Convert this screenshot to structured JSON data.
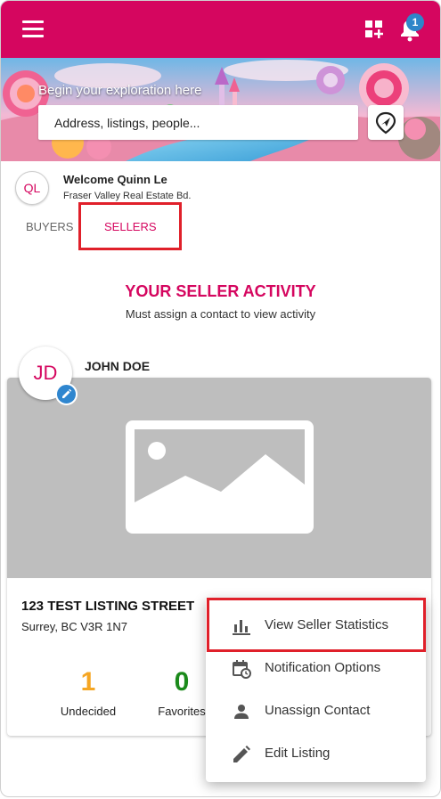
{
  "header": {
    "notification_count": "1",
    "brand_color": "#d5065f",
    "icons": [
      "menu-icon",
      "dashboard-add-icon",
      "notifications-icon"
    ]
  },
  "banner": {
    "title": "Begin your exploration here",
    "search_placeholder": "Address, listings, people..."
  },
  "user": {
    "initials": "QL",
    "welcome": "Welcome Quinn Le",
    "board": "Fraser Valley Real Estate Bd."
  },
  "tabs": [
    {
      "label": "BUYERS",
      "active": false
    },
    {
      "label": "SELLERS",
      "active": true
    }
  ],
  "activity": {
    "title": "YOUR SELLER ACTIVITY",
    "subtitle": "Must assign a contact to view activity"
  },
  "listing": {
    "contact_initials": "JD",
    "contact_name": "JOHN DOE",
    "street": "123 TEST LISTING STREET",
    "city": "Surrey, BC V3R 1N7",
    "stats": [
      {
        "value": "1",
        "label": "Undecided",
        "color": "#f5a623"
      },
      {
        "value": "0",
        "label": "Favorites",
        "color": "#1b8a1b"
      }
    ]
  },
  "menu": {
    "items": [
      {
        "label": "View Seller Statistics",
        "icon": "bar-chart-icon",
        "highlighted": true
      },
      {
        "label": "Notification Options",
        "icon": "calendar-clock-icon"
      },
      {
        "label": "Unassign Contact",
        "icon": "person-icon"
      },
      {
        "label": "Edit Listing",
        "icon": "pencil-icon"
      }
    ]
  },
  "colors": {
    "accent": "#d5065f",
    "highlight_box": "#e0202a",
    "edit_badge": "#2f86cf"
  }
}
